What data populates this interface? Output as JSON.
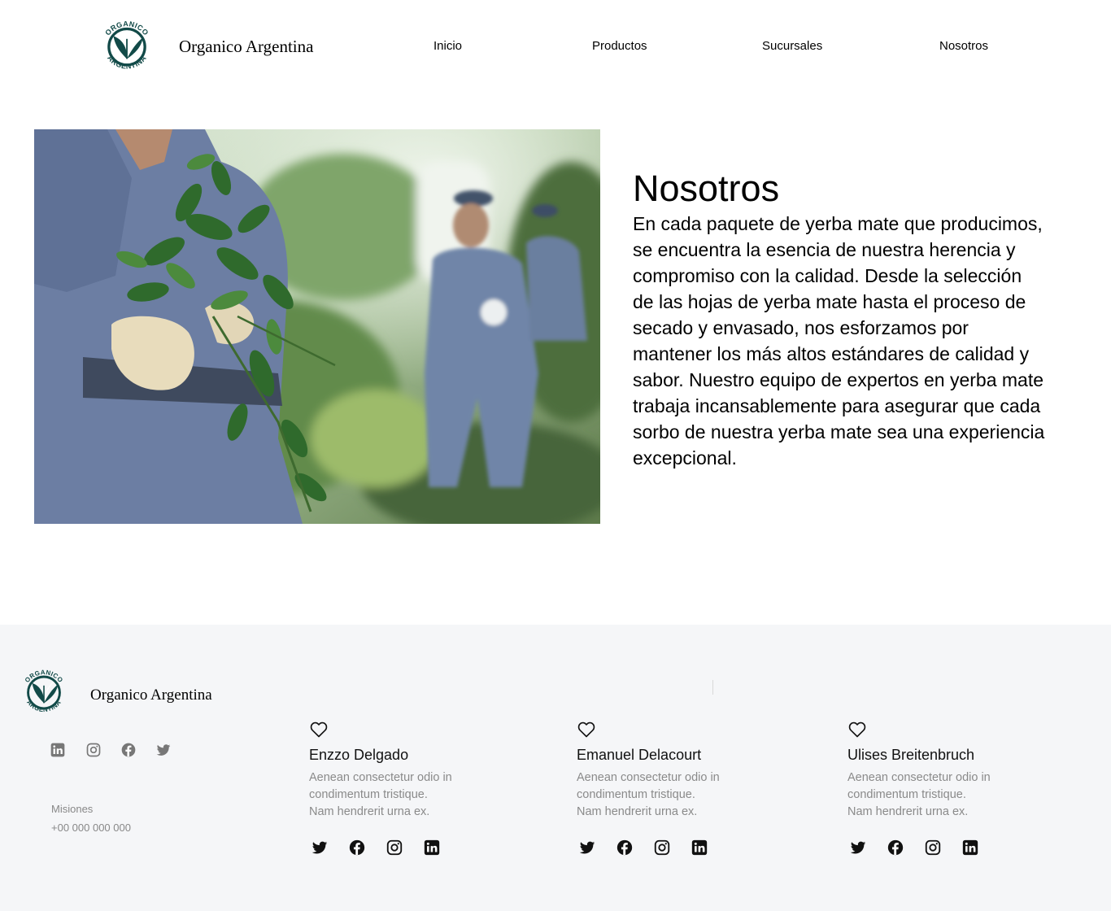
{
  "brand": {
    "name": "Organico Argentina",
    "logo_text_top": "ORGANICO",
    "logo_text_bottom": "ARGENTINA",
    "color": "#124a48"
  },
  "nav": {
    "items": [
      "Inicio",
      "Productos",
      "Sucursales",
      "Nosotros"
    ]
  },
  "hero": {
    "title": "Nosotros",
    "text": "En cada paquete de yerba mate que producimos, se encuentra la esencia de nuestra herencia y compromiso con la calidad. Desde la selección de las hojas de yerba mate hasta el proceso de secado y envasado, nos esforzamos por mantener los más altos estándares de calidad y sabor. Nuestro equipo de expertos en yerba mate trabaja incansablemente para asegurar que cada sorbo de nuestra yerba mate sea una experiencia excepcional."
  },
  "footer": {
    "brand_name": "Organico Argentina",
    "social_icons": [
      "linkedin-icon",
      "instagram-icon",
      "facebook-icon",
      "twitter-icon"
    ],
    "location": "Misiones",
    "phone": "+00 000 000 000",
    "background": "#f5f6f8"
  },
  "team": [
    {
      "name": "Enzzo Delgado",
      "description": "Aenean consectetur odio in condimentum tristique. Nam hendrerit urna ex."
    },
    {
      "name": "Emanuel Delacourt",
      "description": "Aenean consectetur odio in condimentum tristique. Nam hendrerit urna ex."
    },
    {
      "name": "Ulises Breitenbruch",
      "description": "Aenean consectetur odio in condimentum tristique. Nam hendrerit urna ex."
    }
  ],
  "member_social_icons": [
    "twitter-icon",
    "facebook-icon",
    "instagram-icon",
    "linkedin-icon"
  ]
}
